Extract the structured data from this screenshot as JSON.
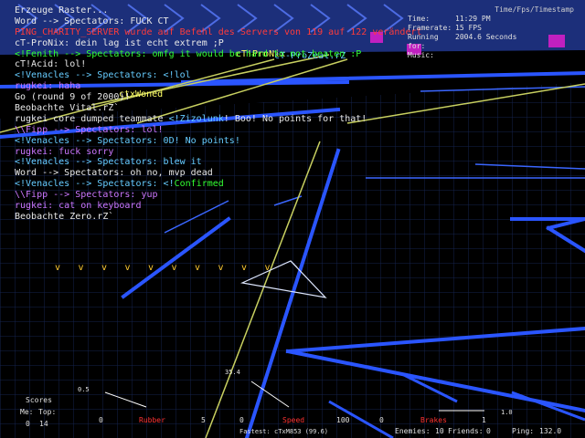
{
  "chat": [
    {
      "segments": [
        {
          "t": "Erzeuge Raster...",
          "c": "w"
        }
      ]
    },
    {
      "segments": [
        {
          "t": "Word --> Spectators: FUCK CT",
          "c": "w"
        }
      ]
    },
    {
      "segments": [
        {
          "t": "PING_CHARITY_SERVER wurde auf Befehl des Servers von 119 auf 122 verändert",
          "c": "r"
        }
      ]
    },
    {
      "segments": [
        {
          "t": "cT-ProNix: dein lag ist echt extrem ;P",
          "c": "w"
        }
      ]
    },
    {
      "segments": [
        {
          "t": "<!Fenith --> Spectators: omfg it would be hard to not beaten :P",
          "c": "g"
        }
      ]
    },
    {
      "segments": [
        {
          "t": "cT!Acid: lol!",
          "c": "w"
        }
      ]
    },
    {
      "segments": [
        {
          "t": "<!Venacles --> Spectators: <!lol",
          "c": "c"
        }
      ]
    },
    {
      "segments": [
        {
          "t": "rugkei: haha",
          "c": "p"
        }
      ]
    },
    {
      "segments": [
        {
          "t": "Go (round 9 of 2000)!",
          "c": "w"
        }
      ]
    },
    {
      "segments": [
        {
          "t": "Beobachte Vital.rZ`",
          "c": "w"
        }
      ]
    },
    {
      "segments": [
        {
          "t": "rugkei core dumped teammate ",
          "c": "w"
        },
        {
          "t": "<!Zizolunk",
          "c": "c"
        },
        {
          "t": "! Boo! No points for that!",
          "c": "w"
        }
      ]
    },
    {
      "segments": [
        {
          "t": "\\\\Fipp --> Spectators: lol!",
          "c": "p"
        }
      ]
    },
    {
      "segments": [
        {
          "t": "<!Venacles --> Spectators: 0D! No points!",
          "c": "c"
        }
      ]
    },
    {
      "segments": [
        {
          "t": "rugkei: fuck sorry",
          "c": "p"
        }
      ]
    },
    {
      "segments": [
        {
          "t": "<!Venacles --> Spectators: blew it",
          "c": "c"
        }
      ]
    },
    {
      "segments": [
        {
          "t": "Word --> Spectators: oh no, mvp dead",
          "c": "w"
        }
      ]
    },
    {
      "segments": [
        {
          "t": "<!Venacles --> Spectators: <!",
          "c": "c"
        },
        {
          "t": "Confirmed",
          "c": "g"
        }
      ]
    },
    {
      "segments": [
        {
          "t": "\\\\Fipp --> Spectators: yup",
          "c": "p"
        }
      ]
    },
    {
      "segments": [
        {
          "t": "rugkei: cat on keyboard",
          "c": "p"
        }
      ]
    },
    {
      "segments": [
        {
          "t": "Beobachte Zero.rZ`",
          "c": "w"
        }
      ]
    }
  ],
  "floating_names": [
    {
      "t": "cT!ProNix",
      "c": "y"
    },
    {
      "t": "cT-ProZeal.rZ",
      "c": "c"
    },
    {
      "t": "ctxWoned",
      "c": "y"
    }
  ],
  "hud": {
    "title": "Time/Fps/Timestamp",
    "time_label": "Time:",
    "time_value": "11:29 PM",
    "framerate_label": "Framerate:",
    "framerate_value": "15 FPS",
    "running_label": "Running for:",
    "running_value": "2004.6 Seconds",
    "music_label": "Music:",
    "music_value": ""
  },
  "chevrons": [
    "v",
    "v",
    "v",
    "v",
    "v",
    "v",
    "v",
    "v",
    "v",
    "v"
  ],
  "bottom": {
    "scores_title": "Scores",
    "me_label": "Me:",
    "top_label": "Top:",
    "me_value": "0",
    "top_value": "14",
    "rubber_label": "Rubber",
    "rubber_min": "0",
    "rubber_max": "5",
    "rubber_gauge_value": "0.5",
    "speed_label": "Speed",
    "speed_min": "0",
    "speed_max": "100",
    "speed_gauge_value": "35.4",
    "brakes_label": "Brakes",
    "brakes_min": "0",
    "brakes_max": "1",
    "brakes_gauge_value": "1.0",
    "fastest_label": "Fastest:",
    "fastest_value": "cTxM853 (99.6)",
    "enemies_label": "Enemies:",
    "enemies_value": "10",
    "friends_label": "Friends:",
    "friends_value": "0",
    "ping_label": "Ping:",
    "ping_value": "132.0"
  },
  "colors": {
    "wall": "#2a55ff",
    "grid": "#1a2a6a",
    "trail": "#c8d060"
  }
}
